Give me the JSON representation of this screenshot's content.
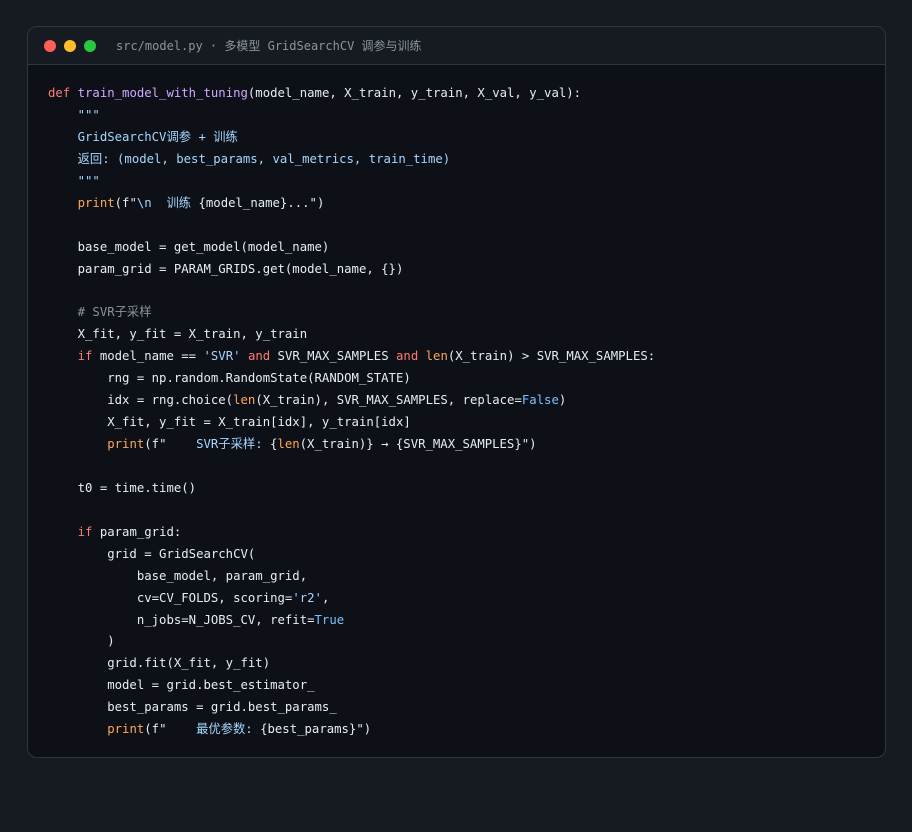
{
  "window": {
    "title": "src/model.py · 多模型 GridSearchCV 调参与训练",
    "traffic_lights": [
      {
        "name": "close",
        "color": "#ff5f57"
      },
      {
        "name": "minimize",
        "color": "#febc2e"
      },
      {
        "name": "maximize",
        "color": "#28c840"
      }
    ]
  },
  "colors": {
    "background": "#161b22",
    "editor_background": "#0d1117",
    "keyword": "#ff7b72",
    "function": "#d2a8ff",
    "string": "#a5d6ff",
    "builtin": "#ffa657",
    "constant": "#79c0ff",
    "comment": "#8b949e",
    "text": "#e6edf3"
  },
  "code": {
    "lines": [
      [
        {
          "t": "def ",
          "k": "kw"
        },
        {
          "t": "train_model_with_tuning",
          "k": "fn"
        },
        {
          "t": "(model_name, X_train, y_train, X_val, y_val):",
          "k": "plain"
        }
      ],
      [
        {
          "t": "    \"\"\"",
          "k": "str"
        }
      ],
      [
        {
          "t": "    GridSearchCV调参 + 训练",
          "k": "str"
        }
      ],
      [
        {
          "t": "    返回: (model, best_params, val_metrics, train_time)",
          "k": "str"
        }
      ],
      [
        {
          "t": "    \"\"\"",
          "k": "str"
        }
      ],
      [
        {
          "t": "    ",
          "k": "plain"
        },
        {
          "t": "print",
          "k": "builtin"
        },
        {
          "t": "(f\"",
          "k": "plain"
        },
        {
          "t": "\\n  训练 ",
          "k": "str"
        },
        {
          "t": "{model_name}...\")",
          "k": "plain"
        }
      ],
      [],
      [
        {
          "t": "    base_model = get_model(model_name)",
          "k": "plain"
        }
      ],
      [
        {
          "t": "    param_grid = PARAM_GRIDS.get(model_name, {})",
          "k": "plain"
        }
      ],
      [],
      [
        {
          "t": "    # SVR子采样",
          "k": "comment"
        }
      ],
      [
        {
          "t": "    X_fit, y_fit = X_train, y_train",
          "k": "plain"
        }
      ],
      [
        {
          "t": "    ",
          "k": "plain"
        },
        {
          "t": "if",
          "k": "kw"
        },
        {
          "t": " model_name == ",
          "k": "plain"
        },
        {
          "t": "'SVR'",
          "k": "str"
        },
        {
          "t": " ",
          "k": "plain"
        },
        {
          "t": "and",
          "k": "kw"
        },
        {
          "t": " SVR_MAX_SAMPLES ",
          "k": "plain"
        },
        {
          "t": "and",
          "k": "kw"
        },
        {
          "t": " ",
          "k": "plain"
        },
        {
          "t": "len",
          "k": "builtin"
        },
        {
          "t": "(X_train) > SVR_MAX_SAMPLES:",
          "k": "plain"
        }
      ],
      [
        {
          "t": "        rng = np.random.RandomState(RANDOM_STATE)",
          "k": "plain"
        }
      ],
      [
        {
          "t": "        idx = rng.choice(",
          "k": "plain"
        },
        {
          "t": "len",
          "k": "builtin"
        },
        {
          "t": "(X_train), SVR_MAX_SAMPLES, replace=",
          "k": "plain"
        },
        {
          "t": "False",
          "k": "const"
        },
        {
          "t": ")",
          "k": "plain"
        }
      ],
      [
        {
          "t": "        X_fit, y_fit = X_train[idx], y_train[idx]",
          "k": "plain"
        }
      ],
      [
        {
          "t": "        ",
          "k": "plain"
        },
        {
          "t": "print",
          "k": "builtin"
        },
        {
          "t": "(f\"    ",
          "k": "plain"
        },
        {
          "t": "SVR子采样: ",
          "k": "str"
        },
        {
          "t": "{",
          "k": "plain"
        },
        {
          "t": "len",
          "k": "builtin"
        },
        {
          "t": "(X_train)} → {SVR_MAX_SAMPLES}\")",
          "k": "plain"
        }
      ],
      [],
      [
        {
          "t": "    t0 = time.time()",
          "k": "plain"
        }
      ],
      [],
      [
        {
          "t": "    ",
          "k": "plain"
        },
        {
          "t": "if",
          "k": "kw"
        },
        {
          "t": " param_grid:",
          "k": "plain"
        }
      ],
      [
        {
          "t": "        grid = GridSearchCV(",
          "k": "plain"
        }
      ],
      [
        {
          "t": "            base_model, param_grid,",
          "k": "plain"
        }
      ],
      [
        {
          "t": "            cv=CV_FOLDS, scoring=",
          "k": "plain"
        },
        {
          "t": "'r2'",
          "k": "str"
        },
        {
          "t": ",",
          "k": "plain"
        }
      ],
      [
        {
          "t": "            n_jobs=N_JOBS_CV, refit=",
          "k": "plain"
        },
        {
          "t": "True",
          "k": "const"
        }
      ],
      [
        {
          "t": "        )",
          "k": "plain"
        }
      ],
      [
        {
          "t": "        grid.fit(X_fit, y_fit)",
          "k": "plain"
        }
      ],
      [
        {
          "t": "        model = grid.best_estimator_",
          "k": "plain"
        }
      ],
      [
        {
          "t": "        best_params = grid.best_params_",
          "k": "plain"
        }
      ],
      [
        {
          "t": "        ",
          "k": "plain"
        },
        {
          "t": "print",
          "k": "builtin"
        },
        {
          "t": "(f\"    ",
          "k": "plain"
        },
        {
          "t": "最优参数: ",
          "k": "str"
        },
        {
          "t": "{best_params}\")",
          "k": "plain"
        }
      ]
    ]
  }
}
